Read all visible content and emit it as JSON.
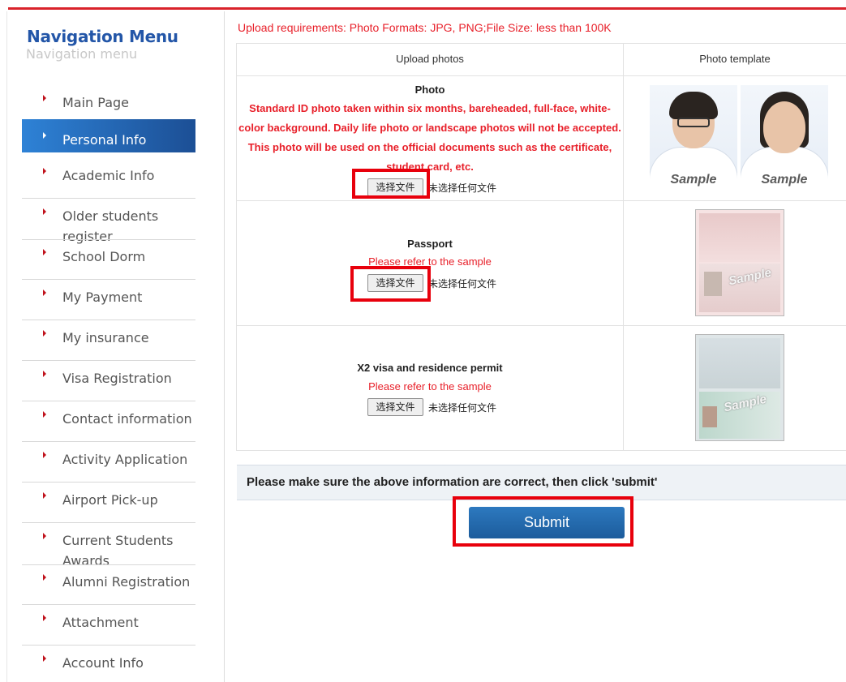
{
  "sidebar": {
    "title": "Navigation Menu",
    "subtitle": "Navigation menu",
    "items": [
      {
        "label": "Main Page"
      },
      {
        "label": "Personal Info"
      },
      {
        "label": "Academic Info"
      },
      {
        "label": "Older students register"
      },
      {
        "label": "School Dorm"
      },
      {
        "label": "My Payment"
      },
      {
        "label": "My insurance"
      },
      {
        "label": "Visa Registration"
      },
      {
        "label": "Contact information"
      },
      {
        "label": "Activity Application"
      },
      {
        "label": "Airport Pick-up"
      },
      {
        "label": "Current Students Awards"
      },
      {
        "label": "Alumni Registration"
      },
      {
        "label": "Attachment"
      },
      {
        "label": "Account Info"
      }
    ]
  },
  "main": {
    "requirements": "Upload requirements: Photo Formats: JPG, PNG;File Size: less than 100K",
    "columns": {
      "upload": "Upload photos",
      "template": "Photo template"
    },
    "rows": [
      {
        "title": "Photo",
        "instructions": [
          "Standard ID photo taken within six months, bareheaded, full-face, white-",
          "color background. Daily life photo or landscape photos will not be accepted.",
          "This photo will be used on the official documents such as the certificate,",
          "student card, etc."
        ],
        "button": "选择文件",
        "status": "未选择任何文件",
        "samples": [
          "Sample",
          "Sample"
        ]
      },
      {
        "title": "Passport",
        "instructions": [
          "Please refer to the sample"
        ],
        "button": "选择文件",
        "status": "未选择任何文件",
        "samples": [
          "Sample"
        ]
      },
      {
        "title": "X2 visa and residence permit",
        "instructions": [
          "Please refer to the sample"
        ],
        "button": "选择文件",
        "status": "未选择任何文件",
        "samples": [
          "Sample"
        ]
      }
    ],
    "notice": "Please make sure the above information are correct, then click 'submit'",
    "submit_label": "Submit"
  },
  "colors": {
    "accent": "#d9232b",
    "highlight": "#e8000c",
    "nav_active": "#1c4f95",
    "submit": "#1c5c9c"
  }
}
